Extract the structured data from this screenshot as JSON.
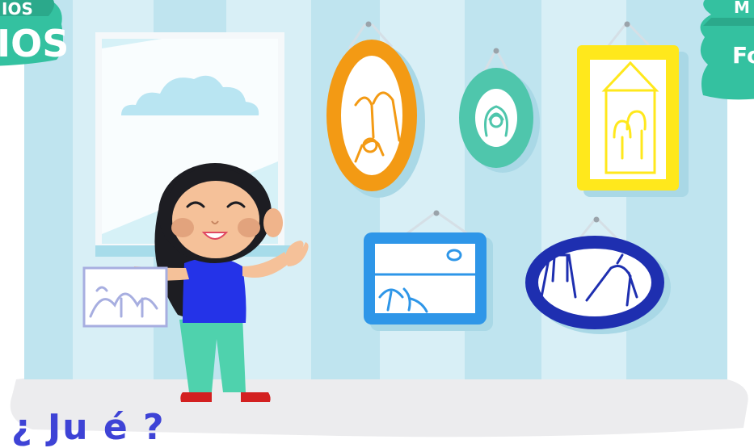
{
  "badge_left": {
    "line1": "IOS",
    "line2": "IOS"
  },
  "badge_right": {
    "line1": "M",
    "line2": "Fo"
  },
  "heading": {
    "text": "¿ Ju é ?"
  },
  "colors": {
    "accent_blue": "#3e43d6",
    "badge_green": "#34c1a0",
    "wall_stripe": "#bfe4ef",
    "frame_orange": "#f39a14",
    "frame_teal": "#4fc6ac",
    "frame_yellow": "#ffe81c",
    "frame_blue": "#2e96e8",
    "frame_navy": "#1e2fb0"
  }
}
